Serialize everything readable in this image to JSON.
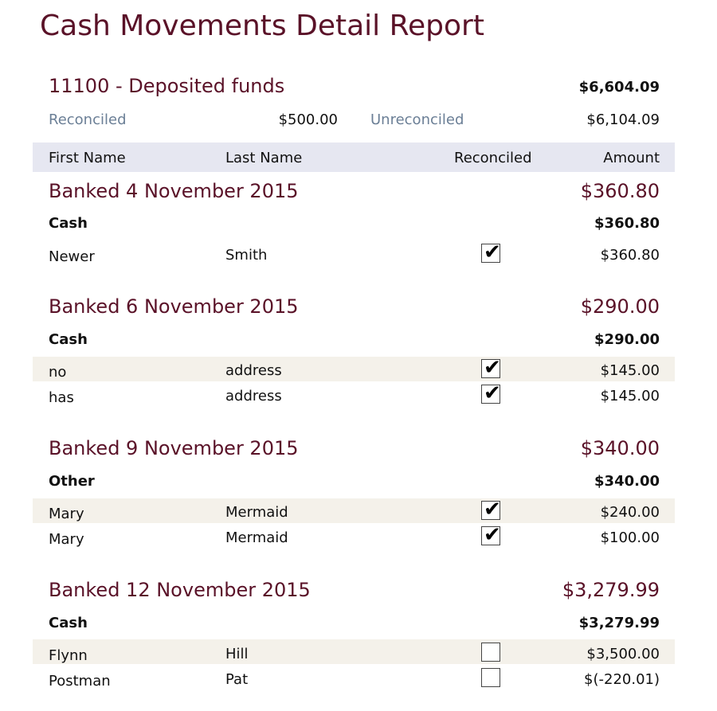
{
  "report": {
    "title": "Cash Movements Detail Report",
    "account": "11100 - Deposited funds",
    "account_total": "$6,604.09",
    "reconciled_label": "Reconciled",
    "reconciled_value": "$500.00",
    "unreconciled_label": "Unreconciled",
    "unreconciled_value": "$6,104.09"
  },
  "columns": {
    "first_name": "First Name",
    "last_name": "Last Name",
    "reconciled": "Reconciled",
    "amount": "Amount"
  },
  "groups": [
    {
      "title": "Banked 4 November 2015",
      "total": "$360.80",
      "method": "Cash",
      "method_total": "$360.80",
      "rows": [
        {
          "first": "Newer",
          "last": "Smith",
          "reconciled": true,
          "amount": "$360.80"
        }
      ]
    },
    {
      "title": "Banked 6 November 2015",
      "total": "$290.00",
      "method": "Cash",
      "method_total": "$290.00",
      "rows": [
        {
          "first": "no",
          "last": "address",
          "reconciled": true,
          "amount": "$145.00"
        },
        {
          "first": "has",
          "last": "address",
          "reconciled": true,
          "amount": "$145.00"
        }
      ]
    },
    {
      "title": "Banked 9 November 2015",
      "total": "$340.00",
      "method": "Other",
      "method_total": "$340.00",
      "rows": [
        {
          "first": "Mary",
          "last": "Mermaid",
          "reconciled": true,
          "amount": "$240.00"
        },
        {
          "first": "Mary",
          "last": "Mermaid",
          "reconciled": true,
          "amount": "$100.00"
        }
      ]
    },
    {
      "title": "Banked 12 November 2015",
      "total": "$3,279.99",
      "method": "Cash",
      "method_total": "$3,279.99",
      "rows": [
        {
          "first": "Flynn",
          "last": "Hill",
          "reconciled": false,
          "amount": "$3,500.00"
        },
        {
          "first": "Postman",
          "last": "Pat",
          "reconciled": false,
          "amount": "$(-220.01)"
        }
      ]
    }
  ]
}
